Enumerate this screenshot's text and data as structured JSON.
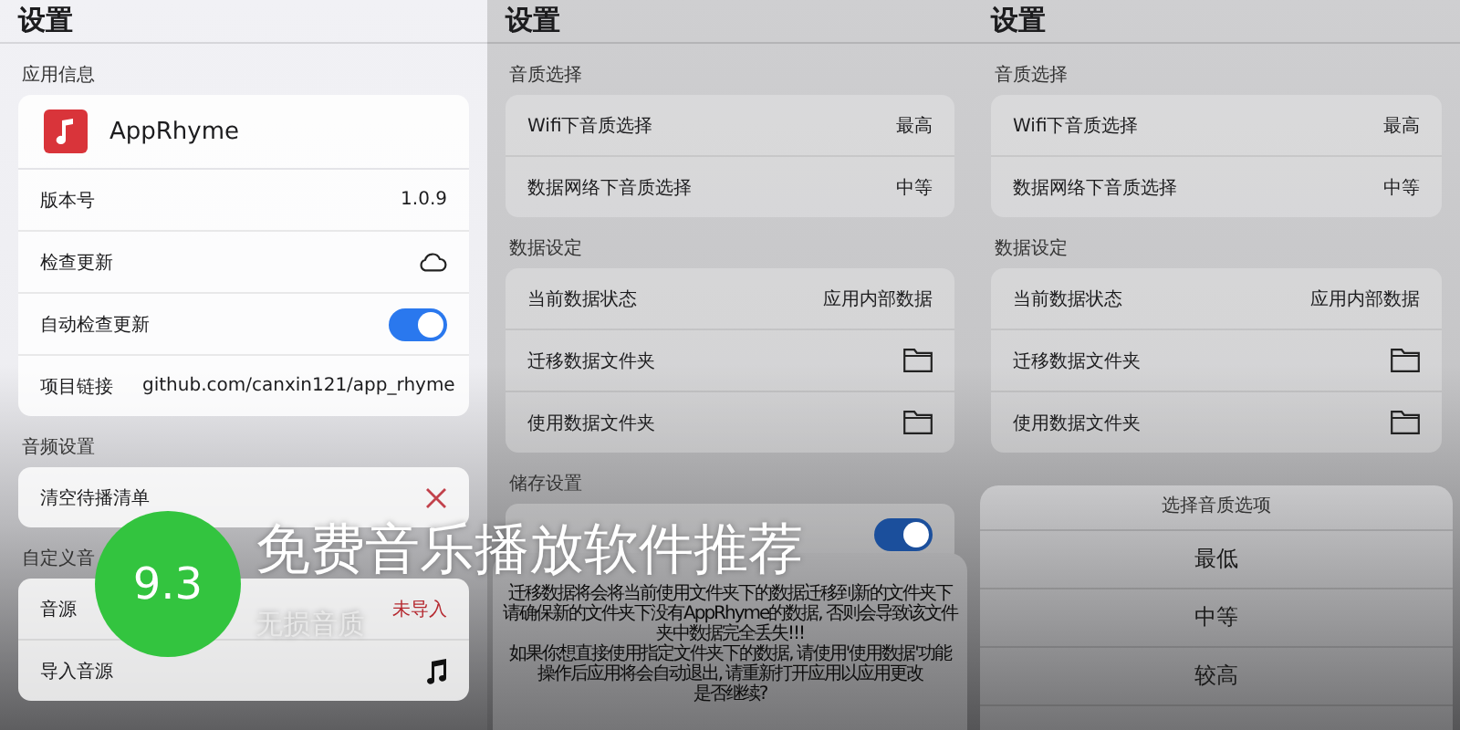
{
  "panels": [
    {
      "dimmed": false,
      "title": "设置",
      "sections": [
        {
          "label": "应用信息",
          "app": {
            "name": "AppRhyme"
          },
          "rows": [
            {
              "kind": "value",
              "label": "版本号",
              "value": "1.0.9"
            },
            {
              "kind": "sync",
              "label": "检查更新"
            },
            {
              "kind": "toggle",
              "label": "自动检查更新",
              "on": true
            },
            {
              "kind": "value",
              "label": "项目链接",
              "value": "github.com/canxin121/app_rhyme"
            }
          ]
        },
        {
          "label": "音频设置",
          "rows": [
            {
              "kind": "clear",
              "label": "清空待播清单"
            }
          ]
        },
        {
          "label": "自定义音",
          "rows": [
            {
              "kind": "status",
              "label": "音源",
              "value": "未导入"
            },
            {
              "kind": "import",
              "label": "导入音源"
            }
          ]
        }
      ]
    },
    {
      "dimmed": true,
      "title": "设置",
      "sections": [
        {
          "label": "音质选择",
          "rows": [
            {
              "kind": "value",
              "label": "Wifi下音质选择",
              "value": "最高"
            },
            {
              "kind": "value",
              "label": "数据网络下音质选择",
              "value": "中等"
            }
          ]
        },
        {
          "label": "数据设定",
          "rows": [
            {
              "kind": "value",
              "label": "当前数据状态",
              "value": "应用内部数据"
            },
            {
              "kind": "folder",
              "label": "迁移数据文件夹"
            },
            {
              "kind": "folder",
              "label": "使用数据文件夹"
            }
          ]
        },
        {
          "label": "储存设置",
          "rows": [
            {
              "kind": "toggle",
              "on": true
            }
          ]
        }
      ],
      "dialog": {
        "lines": [
          "迁移数据将会将当前使用文件夹下的数据迁移到新的文件夹下",
          "请确保新的文件夹下没有AppRhyme的数据, 否则会导致该文件夹中数据完全丢失!!!",
          "如果你想直接使用指定文件夹下的数据, 请使用'使用数据'功能",
          "操作后应用将会自动退出, 请重新打开应用以应用更改",
          "是否继续?"
        ]
      }
    },
    {
      "dimmed": true,
      "title": "设置",
      "sections": [
        {
          "label": "音质选择",
          "rows": [
            {
              "kind": "value",
              "label": "Wifi下音质选择",
              "value": "最高"
            },
            {
              "kind": "value",
              "label": "数据网络下音质选择",
              "value": "中等"
            }
          ]
        },
        {
          "label": "数据设定",
          "rows": [
            {
              "kind": "value",
              "label": "当前数据状态",
              "value": "应用内部数据"
            },
            {
              "kind": "folder",
              "label": "迁移数据文件夹"
            },
            {
              "kind": "folder",
              "label": "使用数据文件夹"
            }
          ]
        }
      ],
      "sheet": {
        "title": "选择音质选项",
        "options": [
          "最低",
          "中等",
          "较高"
        ]
      }
    }
  ],
  "overlay": {
    "score": "9.3",
    "title": "免费音乐播放软件推荐",
    "subtitle": "无损音质"
  }
}
